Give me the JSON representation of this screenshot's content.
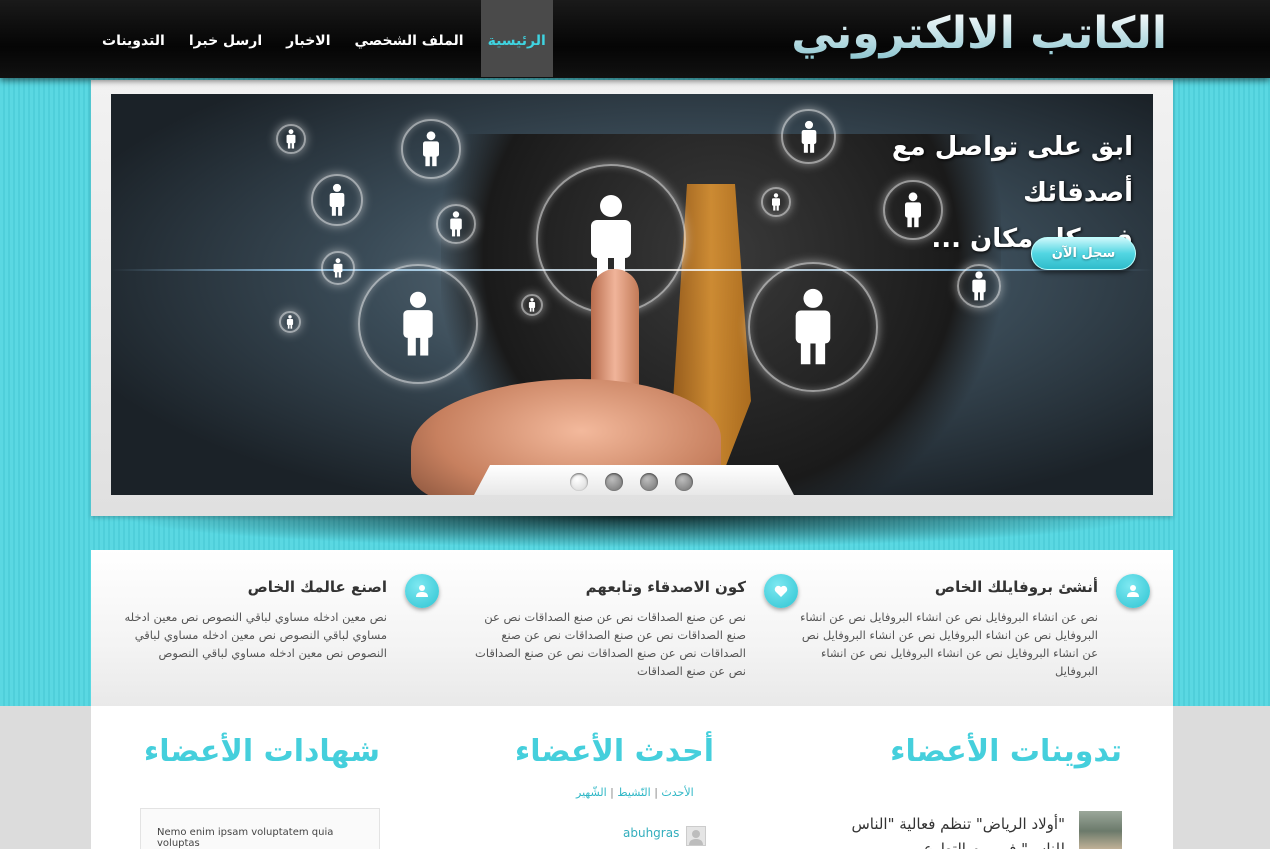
{
  "header": {
    "logo": "الكاتب الالكتروني",
    "nav": [
      {
        "label": "الرئيسية",
        "active": true
      },
      {
        "label": "الملف الشخصي",
        "active": false
      },
      {
        "label": "الاخبار",
        "active": false
      },
      {
        "label": "ارسل خبرا",
        "active": false
      },
      {
        "label": "التدوينات",
        "active": false
      }
    ]
  },
  "slider": {
    "caption_line1": "ابق على تواصل مع أصدقائك",
    "caption_line2": "في كل مكان ...",
    "button": "سجل الآن",
    "dots": 4,
    "active_dot": 1
  },
  "features": [
    {
      "title": "أنشئ بروفايلك الخاص",
      "icon": "user-icon",
      "text": "نص عن انشاء البروفايل نص عن انشاء البروفايل نص عن انشاء البروفايل نص عن انشاء البروفايل نص عن انشاء البروفايل نص عن انشاء البروفايل نص عن انشاء البروفايل نص عن انشاء البروفايل"
    },
    {
      "title": "كون الاصدقاء وتابعهم",
      "icon": "heart-icon",
      "text": "نص عن صنع الصداقات نص عن صنع الصداقات نص عن صنع الصداقات نص عن صنع الصداقات نص عن صنع الصداقات نص عن صنع الصداقات نص عن صنع الصداقات نص عن صنع الصداقات"
    },
    {
      "title": "اصنع عالمك الخاص",
      "icon": "user-icon",
      "text": "نص معين ادخله مساوي لباقي النصوص نص معين ادخله مساوي لباقي النصوص نص معين ادخله مساوي لباقي النصوص نص معين ادخله مساوي لباقي النصوص"
    }
  ],
  "bottom": {
    "blogs_title": "تدوينات الأعضاء",
    "members_title": "أحدث الأعضاء",
    "testimonials_title": "شهادات الأعضاء",
    "filters": [
      "الأحدث",
      "النّشيط",
      "الشّهير"
    ],
    "latest_member": "abuhgras",
    "testimonial_text": "Nemo enim ipsam voluptatem quia voluptas",
    "blog_entry": "\"أولاد الرياض\" تنظم فعالية \"الناس للناس\" في يوم التطوع"
  },
  "colors": {
    "accent": "#45cfdc",
    "header_bg": "#0a0a0a",
    "band": "#55d6e0"
  }
}
